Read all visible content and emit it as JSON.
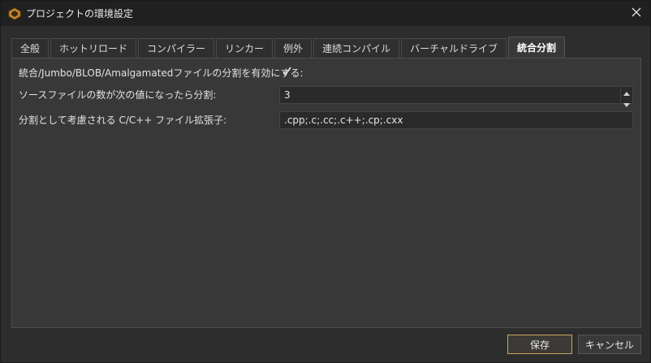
{
  "window": {
    "title": "プロジェクトの環境設定"
  },
  "tabs": [
    {
      "label": "全般",
      "active": false
    },
    {
      "label": "ホットリロード",
      "active": false
    },
    {
      "label": "コンパイラー",
      "active": false
    },
    {
      "label": "リンカー",
      "active": false
    },
    {
      "label": "例外",
      "active": false
    },
    {
      "label": "連続コンパイル",
      "active": false
    },
    {
      "label": "バーチャルドライブ",
      "active": false
    },
    {
      "label": "統合分割",
      "active": true
    }
  ],
  "settings": {
    "enable_label": "統合/Jumbo/BLOB/Amalgamatedファイルの分割を有効にする:",
    "enable_checked": true,
    "threshold_label": "ソースファイルの数が次の値になったら分割:",
    "threshold_value": "3",
    "extensions_label": "分割として考慮される C/C++ ファイル拡張子:",
    "extensions_value": ".cpp;.c;.cc;.c++;.cp;.cxx"
  },
  "footer": {
    "save_label": "保存",
    "cancel_label": "キャンセル"
  },
  "colors": {
    "accent": "#c9a45c",
    "background": "#2d2d2d",
    "panel": "#383838"
  }
}
